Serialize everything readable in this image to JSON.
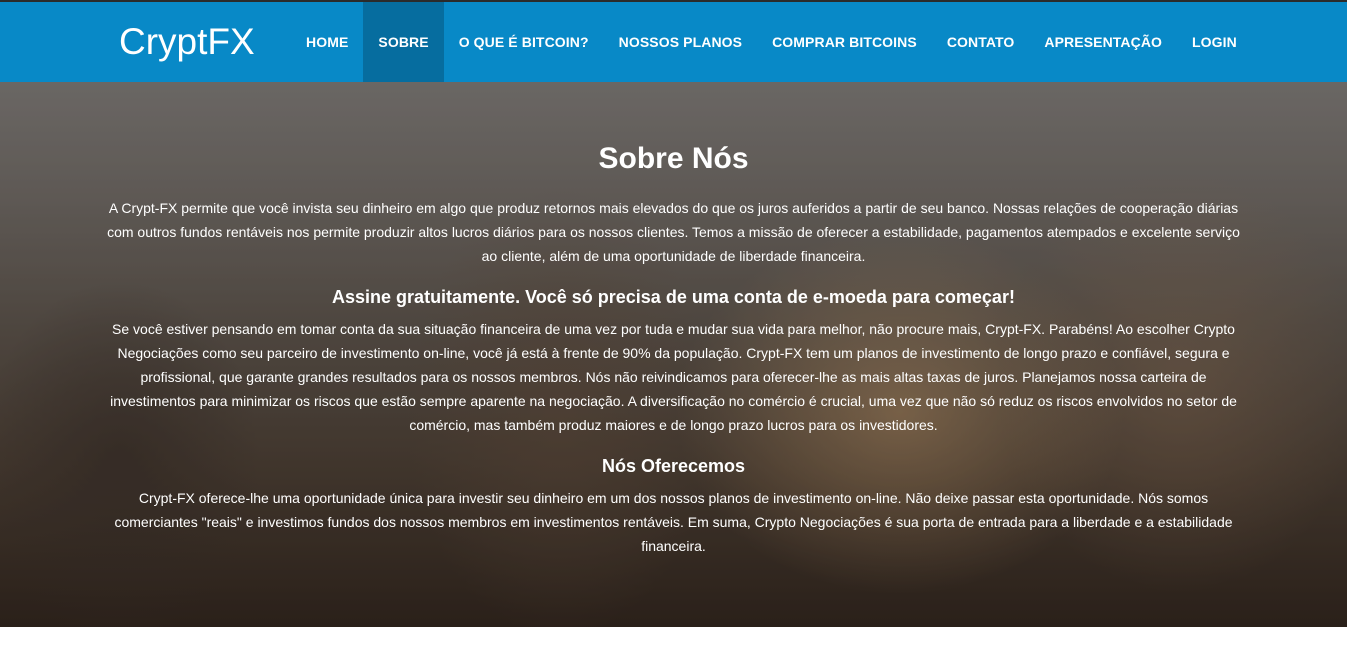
{
  "brand": "CryptFX",
  "nav": [
    {
      "label": "HOME"
    },
    {
      "label": "SOBRE"
    },
    {
      "label": "O QUE É BITCOIN?"
    },
    {
      "label": "NOSSOS PLANOS"
    },
    {
      "label": "COMPRAR BITCOINS"
    },
    {
      "label": "CONTATO"
    },
    {
      "label": "APRESENTAÇÃO"
    },
    {
      "label": "LOGIN"
    }
  ],
  "active_nav": "SOBRE",
  "colors": {
    "navbar": "#0889c7",
    "nav_active": "#066d9f",
    "text": "#ffffff"
  },
  "hero": {
    "title": "Sobre Nós",
    "intro": "A Crypt-FX permite que você invista seu dinheiro em algo que produz retornos mais elevados do que os juros auferidos a partir de seu banco. Nossas relações de cooperação diárias com outros fundos rentáveis nos permite produzir altos lucros diários para os nossos clientes. Temos a missão de oferecer a estabilidade, pagamentos atempados e excelente serviço ao cliente, além de uma oportunidade de liberdade financeira.",
    "subtitle1": "Assine gratuitamente. Você só precisa de uma conta de e-moeda para começar!",
    "para1": "Se você estiver pensando em tomar conta da sua situação financeira de uma vez por tuda e mudar sua vida para melhor, não procure mais, Crypt-FX. Parabéns! Ao escolher Crypto Negociações como seu parceiro de investimento on-line, você já está à frente de 90% da população. Crypt-FX tem um planos de investimento de longo prazo e confiável, segura e profissional, que garante grandes resultados para os nossos membros. Nós não reivindicamos para oferecer-lhe as mais altas taxas de juros. Planejamos nossa carteira de investimentos para minimizar os riscos que estão sempre aparente na negociação. A diversificação no comércio é crucial, uma vez que não só reduz os riscos envolvidos no setor de comércio, mas também produz maiores e de longo prazo lucros para os investidores.",
    "subtitle2": "Nós Oferecemos",
    "para2": "Crypt-FX oferece-lhe uma oportunidade única para investir seu dinheiro em um dos nossos planos de investimento on-line. Não deixe passar esta oportunidade. Nós somos comerciantes \"reais\" e investimos fundos dos nossos membros em investimentos rentáveis. Em suma, Crypto Negociações é sua porta de entrada para a liberdade e a estabilidade financeira."
  }
}
